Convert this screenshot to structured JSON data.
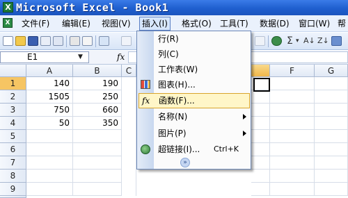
{
  "window": {
    "title": "Microsoft Excel - Book1",
    "app_icon_glyph": "X"
  },
  "menubar": {
    "items": [
      "文件(F)",
      "编辑(E)",
      "视图(V)",
      "插入(I)",
      "格式(O)",
      "工具(T)",
      "数据(D)",
      "窗口(W)",
      "帮"
    ]
  },
  "toolbar": {
    "sigma": "Σ",
    "sort": "A↓",
    "zoom_text": "Z↓"
  },
  "formula_bar": {
    "cell_ref": "E1",
    "fx": "fx",
    "value": ""
  },
  "grid": {
    "columns": [
      "A",
      "B",
      "C",
      "D",
      "E",
      "F",
      "G"
    ],
    "rows": [
      "1",
      "2",
      "3",
      "4",
      "5",
      "6",
      "7",
      "8",
      "9",
      "10"
    ],
    "data": [
      [
        "140",
        "190"
      ],
      [
        "1505",
        "250"
      ],
      [
        "750",
        "660"
      ],
      [
        "50",
        "350"
      ]
    ]
  },
  "insert_menu": {
    "items": [
      {
        "label": "行(R)"
      },
      {
        "label": "列(C)"
      },
      {
        "label": "工作表(W)"
      },
      {
        "label": "图表(H)..."
      },
      {
        "label": "函数(F)..."
      },
      {
        "label": "名称(N)"
      },
      {
        "label": "图片(P)"
      },
      {
        "label": "超链接(I)...",
        "shortcut": "Ctrl+K"
      }
    ],
    "more_glyph": "»"
  },
  "colors": {
    "titlebar": "#1f5fcf",
    "highlight": "#fff6c8",
    "active_row": "#f6c563"
  }
}
